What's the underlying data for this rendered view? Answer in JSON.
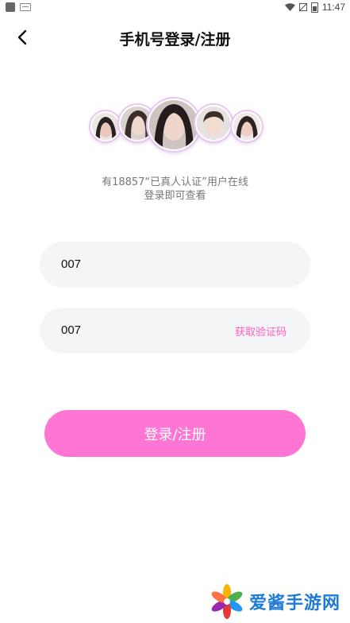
{
  "status_bar": {
    "time": "11:47"
  },
  "header": {
    "title": "手机号登录/注册",
    "back_icon": "back-arrow-icon"
  },
  "promo": {
    "line1": "有18857“已真人认证”用户在线",
    "line2": "登录即可查看"
  },
  "form": {
    "phone_value": "007",
    "code_value": "007",
    "get_code_label": "获取验证码"
  },
  "actions": {
    "login_label": "登录/注册"
  },
  "watermark": {
    "text": "爱酱手游网"
  },
  "colors": {
    "accent": "#ff75d3",
    "link": "#ff5cbf",
    "watermark": "#1d7bd8"
  }
}
